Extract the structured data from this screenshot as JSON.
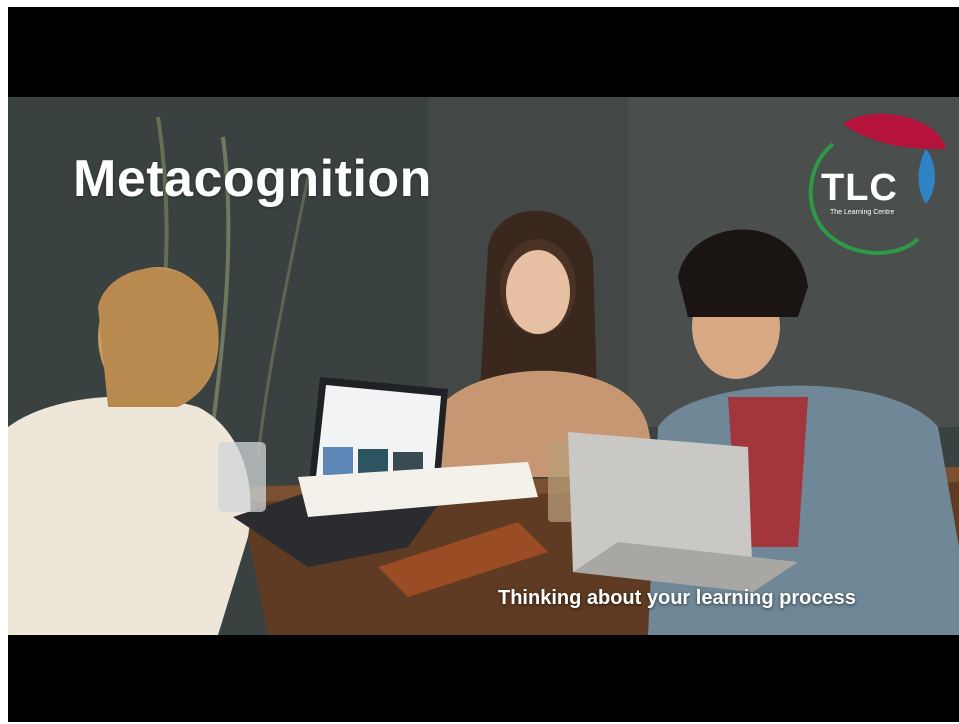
{
  "video": {
    "title": "Metacognition",
    "subtitle": "Thinking about your learning process"
  },
  "logo": {
    "letters": "TLC",
    "tagline": "The Learning Centre",
    "colors": {
      "ring": "#2e9a47",
      "leaf_red": "#b5133b",
      "leaf_blue": "#2f82c4"
    }
  },
  "colors": {
    "letterbox": "#000000",
    "text": "#ffffff"
  }
}
